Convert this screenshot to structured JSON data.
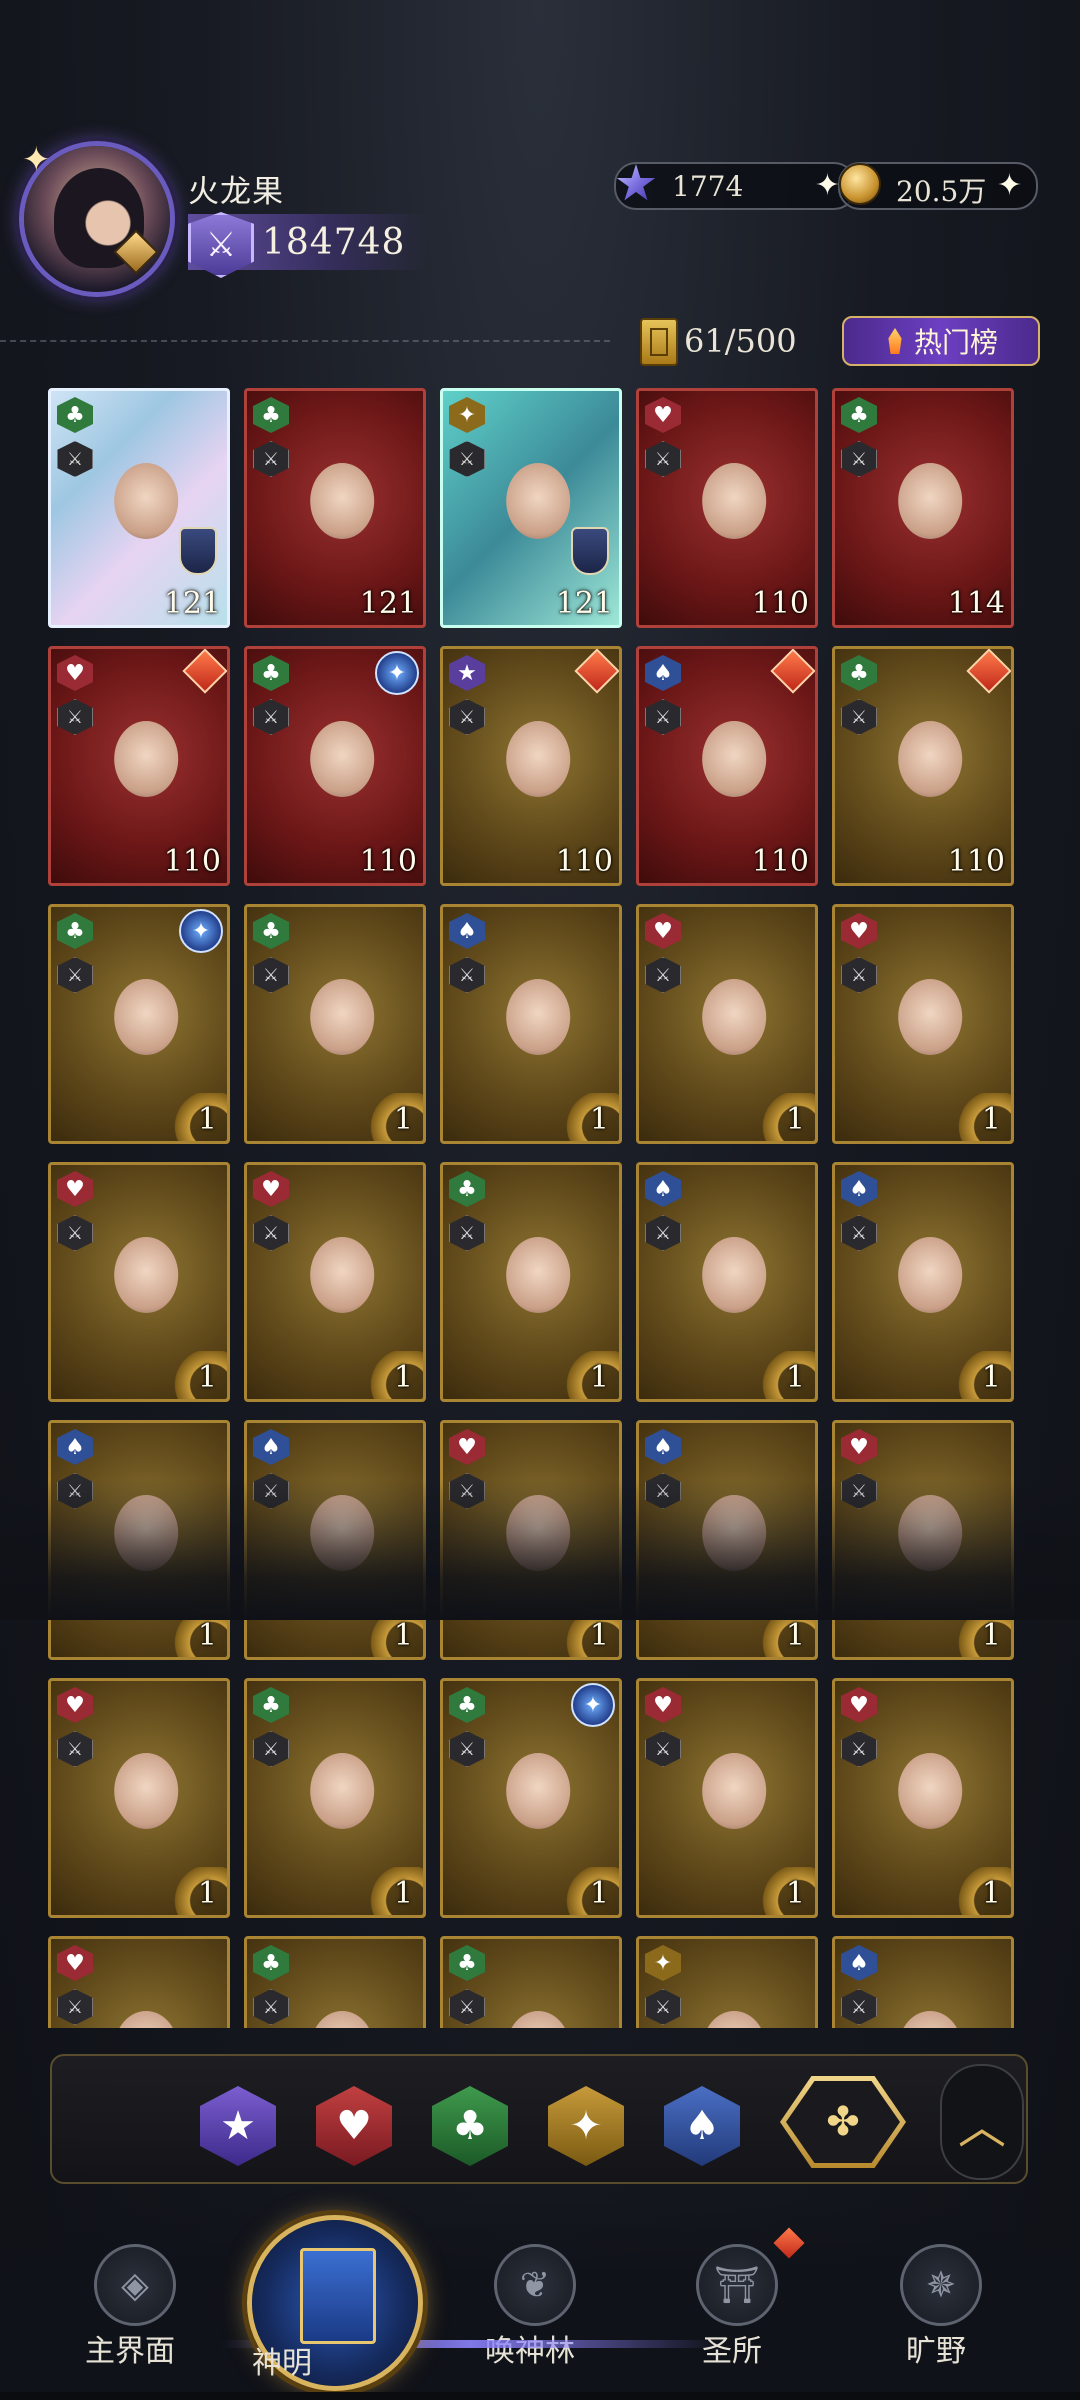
{
  "header": {
    "player_name": "火龙果",
    "power": "184748",
    "currency_gems": "1774",
    "currency_coins": "20.5万",
    "capacity": "61/500",
    "hot_button": "热门榜"
  },
  "cards": [
    {
      "suit": "♣",
      "level": "121",
      "style": "holo"
    },
    {
      "suit": "♣",
      "level": "121",
      "style": "red"
    },
    {
      "suit": "✦",
      "level": "121",
      "style": "teal"
    },
    {
      "suit": "♥",
      "level": "110",
      "style": "red"
    },
    {
      "suit": "♣",
      "level": "114",
      "style": "red"
    },
    {
      "suit": "♥",
      "level": "110",
      "style": "red"
    },
    {
      "suit": "♣",
      "level": "110",
      "style": "red"
    },
    {
      "suit": "★",
      "level": "110",
      "style": "gold"
    },
    {
      "suit": "♠",
      "level": "110",
      "style": "red"
    },
    {
      "suit": "♣",
      "level": "110",
      "style": "gold"
    },
    {
      "suit": "♣",
      "level": "1",
      "style": "gold"
    },
    {
      "suit": "♣",
      "level": "1",
      "style": "gold"
    },
    {
      "suit": "♠",
      "level": "1",
      "style": "gold"
    },
    {
      "suit": "♥",
      "level": "1",
      "style": "gold"
    },
    {
      "suit": "♥",
      "level": "1",
      "style": "gold"
    },
    {
      "suit": "♥",
      "level": "1",
      "style": "gold"
    },
    {
      "suit": "♥",
      "level": "1",
      "style": "gold"
    },
    {
      "suit": "♣",
      "level": "1",
      "style": "gold"
    },
    {
      "suit": "♠",
      "level": "1",
      "style": "gold"
    },
    {
      "suit": "♠",
      "level": "1",
      "style": "gold"
    },
    {
      "suit": "♠",
      "level": "1",
      "style": "gold"
    },
    {
      "suit": "♠",
      "level": "1",
      "style": "gold"
    },
    {
      "suit": "♥",
      "level": "1",
      "style": "gold"
    },
    {
      "suit": "♠",
      "level": "1",
      "style": "gold"
    },
    {
      "suit": "♥",
      "level": "1",
      "style": "gold"
    },
    {
      "suit": "♥",
      "level": "1",
      "style": "gold"
    },
    {
      "suit": "♣",
      "level": "1",
      "style": "gold"
    },
    {
      "suit": "♣",
      "level": "1",
      "style": "gold"
    },
    {
      "suit": "♥",
      "level": "1",
      "style": "gold"
    },
    {
      "suit": "♥",
      "level": "1",
      "style": "gold"
    },
    {
      "suit": "♥",
      "level": "",
      "style": "gold"
    },
    {
      "suit": "♣",
      "level": "",
      "style": "gold"
    },
    {
      "suit": "♣",
      "level": "",
      "style": "gold"
    },
    {
      "suit": "✦",
      "level": "",
      "style": "gold"
    },
    {
      "suit": "♠",
      "level": "",
      "style": "gold"
    }
  ],
  "filters": {
    "star": "★",
    "heart": "♥",
    "club": "♣",
    "diamond": "✦",
    "spade": "♠",
    "all": "✤",
    "collapse": "︿"
  },
  "bottom_nav": {
    "world": "主界面",
    "gods": "神明",
    "summon": "唤神林",
    "sanctuary": "圣所",
    "wilds": "旷野"
  },
  "colors": {
    "accent_gold": "#d9b45e",
    "accent_purple": "#6a5bbf",
    "bg_dark": "#0f1117"
  }
}
